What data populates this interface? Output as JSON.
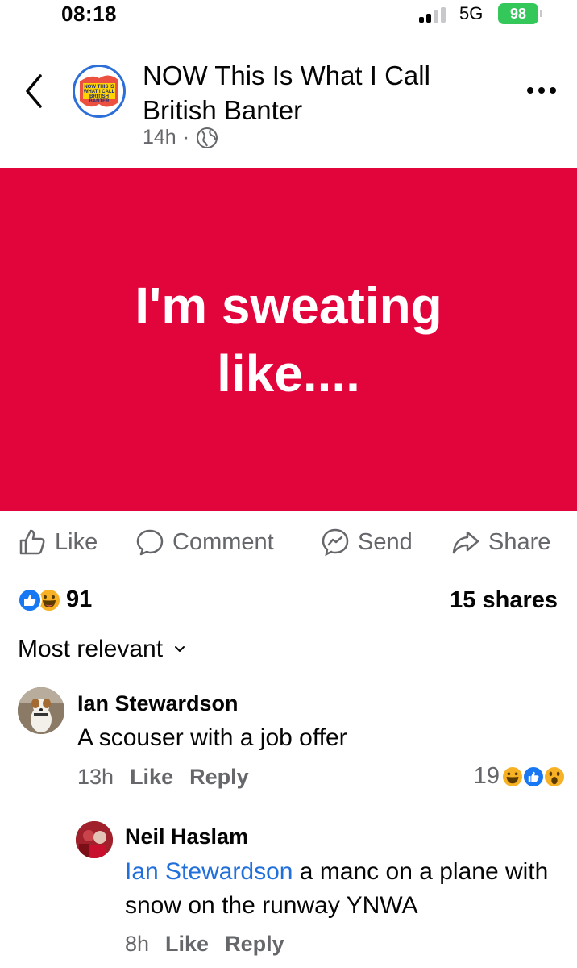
{
  "status_bar": {
    "time": "08:18",
    "network": "5G",
    "battery": "98",
    "battery_color": "#34c759"
  },
  "header": {
    "back_icon": "chevron-left-icon",
    "page_name": "NOW This Is What I Call British Banter",
    "logo_text": [
      "NOW THIS IS",
      "WHAT I CALL",
      "BRITISH",
      "BANTER"
    ],
    "time_ago": "14h",
    "separator": "·",
    "audience_icon": "globe-icon",
    "more_icon": "ellipsis-icon"
  },
  "post": {
    "background_color": "#e1053c",
    "text": "I'm sweating like...."
  },
  "actions": {
    "like": "Like",
    "comment": "Comment",
    "send": "Send",
    "share": "Share"
  },
  "stats": {
    "reaction_icons": [
      "like-reaction-icon",
      "haha-reaction-icon"
    ],
    "reaction_count": "91",
    "shares": "15 shares"
  },
  "sort": {
    "label": "Most relevant",
    "icon": "chevron-down-icon"
  },
  "comments": [
    {
      "author": "Ian Stewardson",
      "text": "A scouser with a job offer",
      "time": "13h",
      "like": "Like",
      "reply": "Reply",
      "reaction_count": "19",
      "reaction_icons": [
        "haha-reaction-icon",
        "like-reaction-icon",
        "wow-reaction-icon"
      ]
    },
    {
      "author": "Neil Haslam",
      "mention": "Ian Stewardson",
      "text": " a manc on a plane with snow on the runway YNWA",
      "time": "8h",
      "like": "Like",
      "reply": "Reply"
    }
  ],
  "colors": {
    "brand_blue": "#216fdb",
    "secondary_text": "#65676b"
  }
}
